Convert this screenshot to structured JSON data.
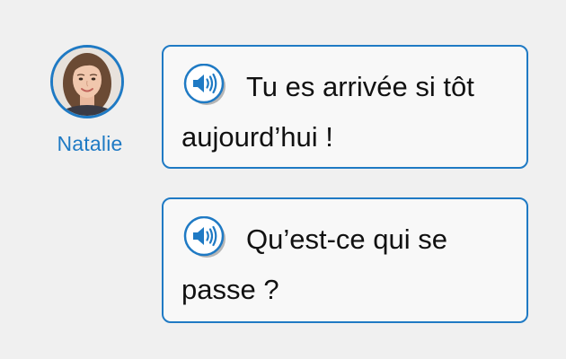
{
  "speaker": {
    "name": "Natalie",
    "avatar_icon": "avatar-photo"
  },
  "colors": {
    "accent": "#1f7ac4",
    "background": "#f0f0f0",
    "bubble_bg": "#f8f8f8",
    "text": "#111111"
  },
  "messages": [
    {
      "audio_icon": "speaker-icon",
      "text": "Tu es arrivée si tôt aujourd’hui !"
    },
    {
      "audio_icon": "speaker-icon",
      "text": "Qu’est-ce qui se passe ?"
    }
  ]
}
